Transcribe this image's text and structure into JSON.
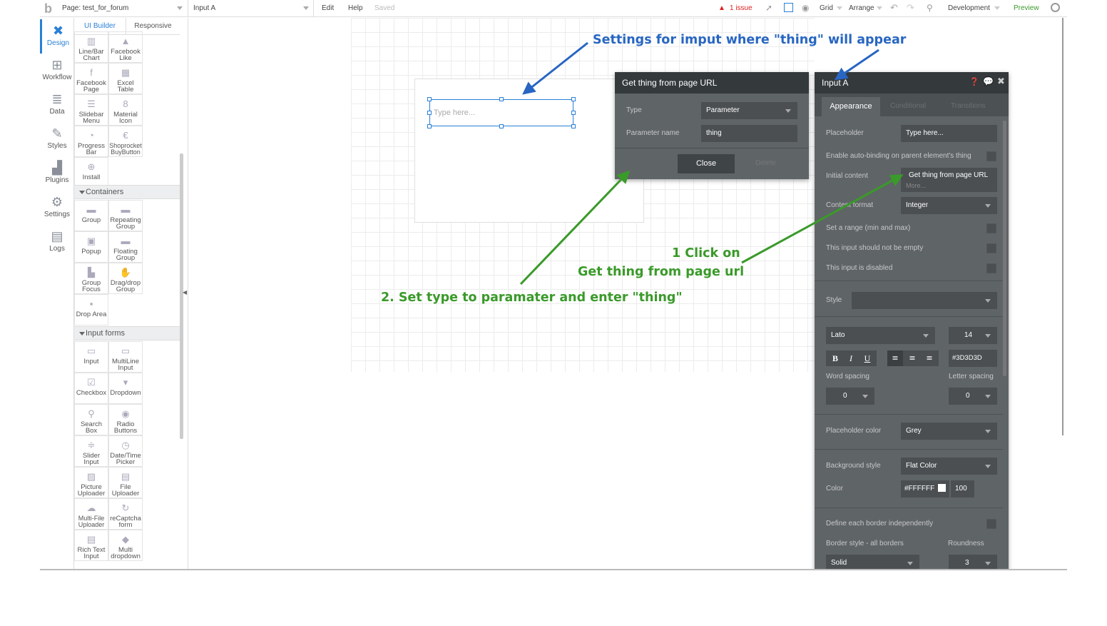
{
  "topbar": {
    "page_label": "Page: test_for_forum",
    "element_select": "Input A",
    "edit": "Edit",
    "help": "Help",
    "saved": "Saved",
    "issues": "1 issue",
    "grid": "Grid",
    "arrange": "Arrange",
    "environment": "Development",
    "preview": "Preview"
  },
  "leftnav": {
    "items": [
      {
        "label": "Design",
        "icon": "design-icon"
      },
      {
        "label": "Workflow",
        "icon": "workflow-icon"
      },
      {
        "label": "Data",
        "icon": "database-icon"
      },
      {
        "label": "Styles",
        "icon": "brush-icon"
      },
      {
        "label": "Plugins",
        "icon": "plugin-icon"
      },
      {
        "label": "Settings",
        "icon": "gear-icon"
      },
      {
        "label": "Logs",
        "icon": "document-icon"
      }
    ]
  },
  "palette": {
    "tabs": [
      "UI Builder",
      "Responsive"
    ],
    "top_items": [
      [
        "Line/Bar Chart",
        "Facebook Like"
      ],
      [
        "Facebook Page",
        "Excel Table"
      ],
      [
        "Slidebar Menu",
        "Material Icon"
      ],
      [
        "Progress Bar",
        "Shoprocket BuyButton"
      ],
      [
        "Install"
      ]
    ],
    "sections": [
      {
        "title": "Containers",
        "items": [
          [
            "Group",
            "Repeating Group"
          ],
          [
            "Popup",
            "Floating Group"
          ],
          [
            "Group Focus",
            "Drag/drop Group"
          ],
          [
            "Drop Area"
          ]
        ]
      },
      {
        "title": "Input forms",
        "items": [
          [
            "Input",
            "MultiLine Input"
          ],
          [
            "Checkbox",
            "Dropdown"
          ],
          [
            "Search Box",
            "Radio Buttons"
          ],
          [
            "Slider Input",
            "Date/Time Picker"
          ],
          [
            "Picture Uploader",
            "File Uploader"
          ],
          [
            "Multi-File Uploader",
            "reCaptcha form"
          ],
          [
            "Rich Text Input",
            "Multi dropdown"
          ]
        ]
      }
    ]
  },
  "canvas": {
    "input_placeholder": "Type here..."
  },
  "url_panel": {
    "title": "Get thing from page URL",
    "type_label": "Type",
    "type_value": "Parameter",
    "param_label": "Parameter name",
    "param_value": "thing",
    "close": "Close",
    "delete": "Delete"
  },
  "inspector": {
    "title": "Input A",
    "tabs": [
      "Appearance",
      "Conditional",
      "Transitions"
    ],
    "placeholder_label": "Placeholder",
    "placeholder_value": "Type here...",
    "autobinding_label": "Enable auto-binding on parent element's thing",
    "initial_content_label": "Initial content",
    "initial_content_value": "Get thing from page URL",
    "more": "More...",
    "content_format_label": "Content format",
    "content_format_value": "Integer",
    "range_label": "Set a range (min and max)",
    "not_empty_label": "This input should not be empty",
    "disabled_label": "This input is disabled",
    "style_label": "Style",
    "font": "Lato",
    "font_size": "14",
    "bold": "B",
    "italic": "I",
    "underline": "U",
    "text_color": "#3D3D3D",
    "word_spacing_label": "Word spacing",
    "word_spacing_value": "0",
    "letter_spacing_label": "Letter spacing",
    "letter_spacing_value": "0",
    "placeholder_color_label": "Placeholder color",
    "placeholder_color_value": "Grey",
    "bg_style_label": "Background style",
    "bg_style_value": "Flat Color",
    "color_label": "Color",
    "color_value": "#FFFFFF",
    "opacity_value": "100",
    "border_indep_label": "Define each border independently",
    "border_style_label": "Border style - all borders",
    "roundness_label": "Roundness",
    "border_style_value": "Solid",
    "roundness_value": "3"
  },
  "annotations": {
    "settings_note": "Settings for imput where \"thing\" will appear",
    "step1_line1": "1 Click on",
    "step1_line2": "Get thing from page url",
    "step2": "2. Set type to paramater and enter \"thing\""
  },
  "colors": {
    "accent": "#2a80d6",
    "annotation_blue": "#2866c2",
    "annotation_green": "#3a9a2a",
    "panel_dark": "#5f6467",
    "panel_header": "#34393c",
    "issue_red": "#e02020",
    "preview_green": "#3a9a2a"
  }
}
